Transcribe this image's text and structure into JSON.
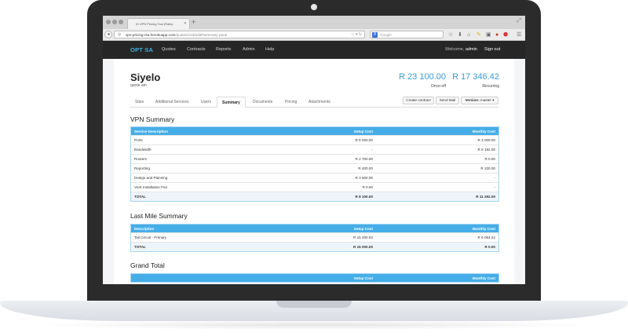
{
  "browser": {
    "tab_title": "IS VPN Pricing Tool (Rails)",
    "url_host": "vpn-pricing-rsa.herokuapp.com",
    "url_path": "/quotes/123/edit#summary-pane",
    "search_placeholder": "Google"
  },
  "navbar": {
    "brand": "OPT SA",
    "links": [
      "Quotes",
      "Contracts",
      "Reports",
      "Admin",
      "Help"
    ],
    "welcome_prefix": "Welcome,",
    "username": "admin",
    "sign_out": "Sign out"
  },
  "quote": {
    "title": "Siyelo",
    "subtitle": "quote am",
    "once_off_amount": "R 23 100.00",
    "once_off_label": "Once-off",
    "recurring_amount": "R 17 346.42",
    "recurring_label": "Recurring"
  },
  "tabs": [
    "Sites",
    "Additional Services",
    "Users",
    "Summary",
    "Documents",
    "Pricing",
    "Attachments"
  ],
  "active_tab": "Summary",
  "actions": {
    "create_contract": "Create contract",
    "send_mail": "Send Mail",
    "version_label": "Version:",
    "version_value": "master"
  },
  "vpn_summary": {
    "title": "VPN Summary",
    "headers": [
      "Service Description",
      "Setup Cost",
      "Monthly Cost"
    ],
    "rows": [
      [
        "Ports",
        "R 5 000.00",
        "R 3 000.00"
      ],
      [
        "Bandwidth",
        "-",
        "R 8 192.00"
      ],
      [
        "Routers",
        "R 2 700.00",
        "R 0.00"
      ],
      [
        "Reporting",
        "R 400.00",
        "R 100.00"
      ],
      [
        "Design and Planning",
        "R 3 500.00",
        "-"
      ],
      [
        "VoIS Installation Fee",
        "R 0.00",
        "-"
      ]
    ],
    "total": [
      "TOTAL",
      "R 8 100.00",
      "R 11 292.00"
    ]
  },
  "last_mile_summary": {
    "title": "Last Mile Summary",
    "headers": [
      "Description",
      "Setup Cost",
      "Monthly Cost"
    ],
    "rows": [
      [
        "Tail Circuit - Primary",
        "R 15 000.00",
        "R 6 054.42"
      ]
    ],
    "total": [
      "TOTAL",
      "R 15 000.00",
      "R 0.00"
    ]
  },
  "grand_total": {
    "title": "Grand Total",
    "headers": [
      "",
      "Setup Cost",
      "Monthly Cost"
    ]
  },
  "colors": {
    "accent": "#45aee8",
    "brand": "#3fb0e6",
    "navbar_bg": "#262626",
    "laptop_frame": "#2b2b2b"
  }
}
